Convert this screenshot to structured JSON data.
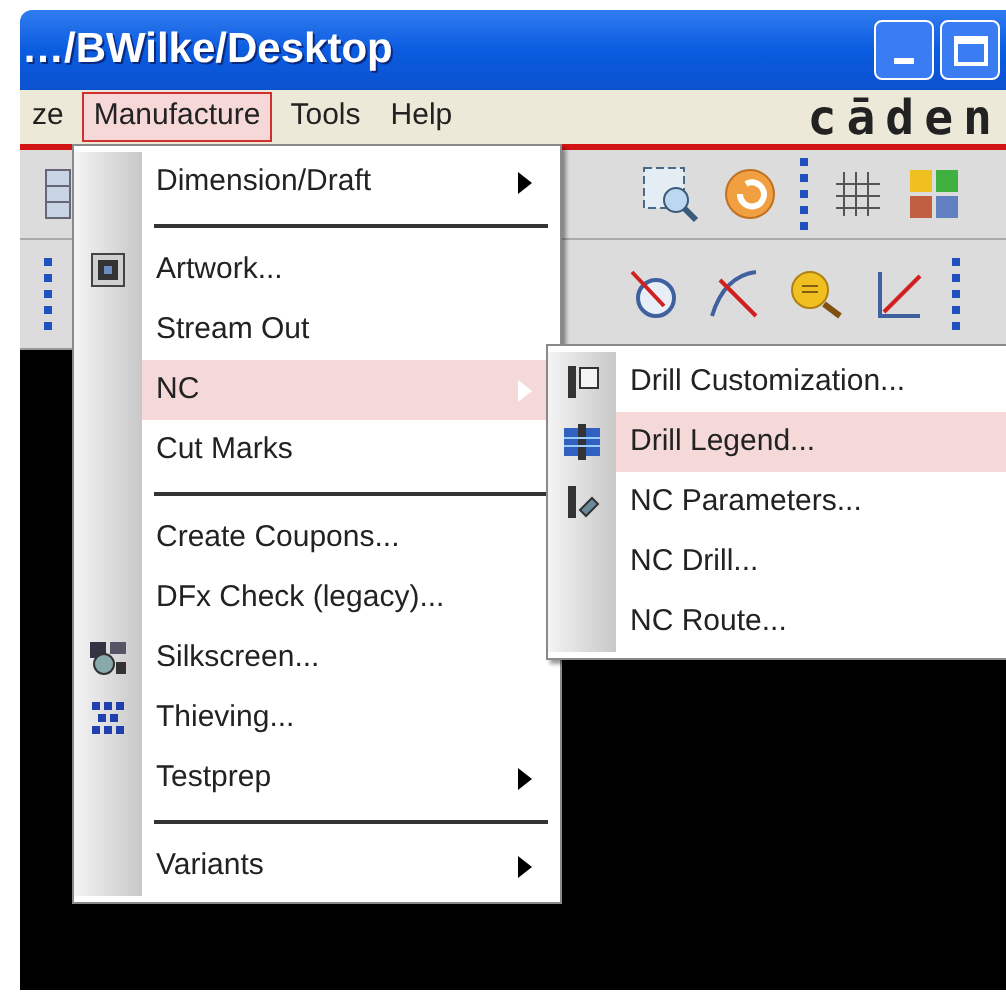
{
  "window": {
    "title": "…/BWilke/Desktop",
    "brand": "cāden"
  },
  "menu_bar": [
    {
      "label": "ze",
      "selected": false
    },
    {
      "label": "Manufacture",
      "selected": true
    },
    {
      "label": "Tools",
      "selected": false
    },
    {
      "label": "Help",
      "selected": false
    }
  ],
  "manufacture_menu": [
    {
      "kind": "plain",
      "label": "Dimension/Draft",
      "submenu": true,
      "selected": false
    },
    {
      "kind": "separator"
    },
    {
      "kind": "with_icon",
      "label": "Artwork...",
      "submenu": false,
      "selected": false
    },
    {
      "kind": "plain",
      "label": "Stream Out",
      "submenu": false,
      "selected": false
    },
    {
      "kind": "plain",
      "label": "NC",
      "submenu": true,
      "selected": true
    },
    {
      "kind": "plain",
      "label": "Cut Marks",
      "submenu": false,
      "selected": false
    },
    {
      "kind": "separator"
    },
    {
      "kind": "plain",
      "label": "Create Coupons...",
      "submenu": false,
      "selected": false
    },
    {
      "kind": "plain",
      "label": "DFx Check (legacy)...",
      "submenu": false,
      "selected": false
    },
    {
      "kind": "with_icon",
      "label": "Silkscreen...",
      "submenu": false,
      "selected": false
    },
    {
      "kind": "with_icon",
      "label": "Thieving...",
      "submenu": false,
      "selected": false
    },
    {
      "kind": "plain",
      "label": "Testprep",
      "submenu": true,
      "selected": false
    },
    {
      "kind": "separator"
    },
    {
      "kind": "plain",
      "label": "Variants",
      "submenu": true,
      "selected": false
    }
  ],
  "nc_submenu": [
    {
      "kind": "with_icon",
      "label": "Drill Customization...",
      "selected": false
    },
    {
      "kind": "with_icon",
      "label": "Drill Legend...",
      "selected": true
    },
    {
      "kind": "with_icon",
      "label": "NC Parameters...",
      "selected": false
    },
    {
      "kind": "plain",
      "label": "NC Drill...",
      "selected": false
    },
    {
      "kind": "plain",
      "label": "NC Route...",
      "selected": false
    }
  ]
}
